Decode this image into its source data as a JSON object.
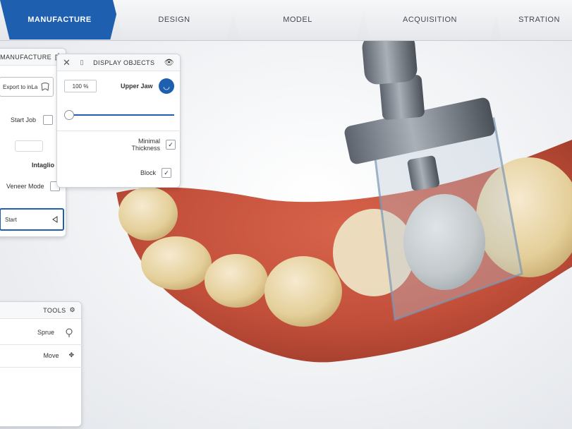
{
  "tabs": [
    {
      "label": "MANUFACTURE",
      "active": true
    },
    {
      "label": "DESIGN",
      "active": false
    },
    {
      "label": "MODEL",
      "active": false
    },
    {
      "label": "ACQUISITION",
      "active": false
    },
    {
      "label": "STRATION",
      "active": false
    }
  ],
  "manufacture_panel": {
    "title": "MANUFACTURE",
    "export_label": "Export to inLa",
    "start_job_label": "Start Job",
    "mode_label": "Intaglio",
    "veneer_label": "Veneer Mode",
    "start_label": "Start"
  },
  "display_objects": {
    "title": "DISPLAY OBJECTS",
    "upper_jaw_label": "Upper Jaw",
    "opacity_value": "100 %",
    "opacity_percent": 100,
    "minimal_thickness_label": "Minimal Thickness",
    "block_label": "Block"
  },
  "tools_panel": {
    "title": "TOOLS",
    "items": [
      {
        "label": "Sprue",
        "icon": "sprue-icon"
      },
      {
        "label": "Move",
        "icon": "move-icon"
      }
    ]
  },
  "colors": {
    "accent": "#1f5fb0",
    "gingiva": "#c8543e",
    "tooth": "#e8d6a8",
    "block": "#c9d2dc"
  }
}
